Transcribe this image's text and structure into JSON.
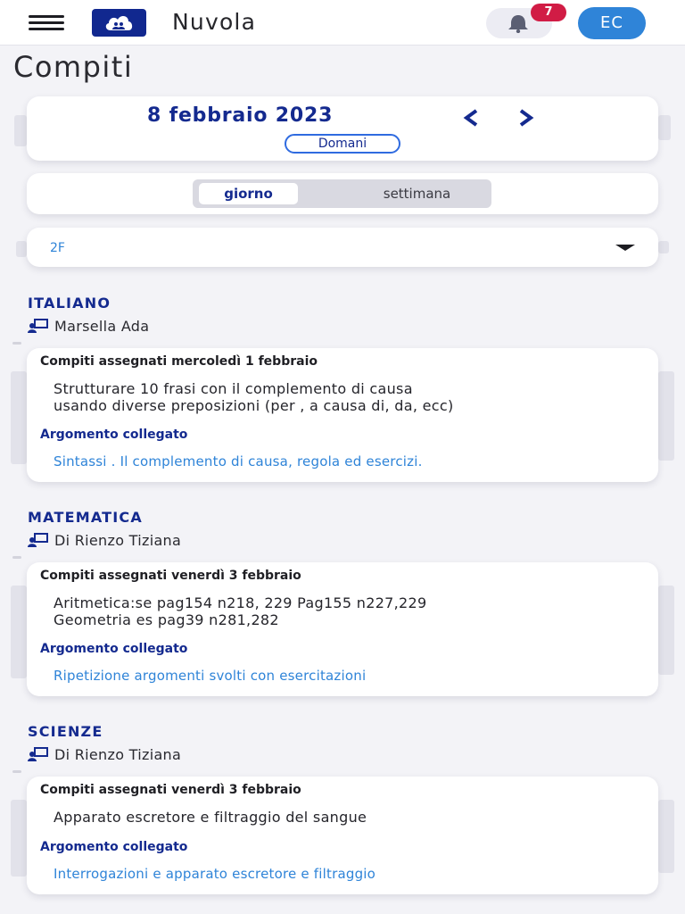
{
  "header": {
    "app_title": "Nuvola",
    "notifications_count": "7",
    "user_initials": "EC",
    "colors": {
      "brand": "#11288f",
      "badge": "#d11c45",
      "avatar": "#2f84d8"
    }
  },
  "page_title": "Compiti",
  "date_nav": {
    "date": "8 febbraio 2023",
    "tomorrow_label": "Domani",
    "prev_icon": "chevron-left-icon",
    "next_icon": "chevron-right-icon"
  },
  "view_toggle": {
    "day_label": "giorno",
    "week_label": "settimana",
    "selected": "giorno"
  },
  "class_select": {
    "value": "2F"
  },
  "subjects": [
    {
      "name": "ITALIANO",
      "teacher": "Marsella Ada",
      "assigned": "Compiti assegnati mercoledì 1 febbraio",
      "lines": [
        "Strutturare 10 frasi con il complemento di causa",
        "usando diverse preposizioni (per , a causa di, da, ecc)"
      ],
      "topic_label": "Argomento collegato",
      "topic": "Sintassi . Il complemento di causa, regola ed esercizi."
    },
    {
      "name": "MATEMATICA",
      "teacher": "Di Rienzo Tiziana",
      "assigned": "Compiti assegnati venerdì 3 febbraio",
      "lines": [
        "Aritmetica:se pag154 n218, 229 Pag155 n227,229",
        "Geometria es pag39 n281,282"
      ],
      "topic_label": "Argomento collegato",
      "topic": "Ripetizione argomenti svolti con esercitazioni"
    },
    {
      "name": "SCIENZE",
      "teacher": "Di Rienzo Tiziana",
      "assigned": "Compiti assegnati venerdì 3 febbraio",
      "lines": [
        "Apparato escretore e filtraggio del sangue"
      ],
      "topic_label": "Argomento collegato",
      "topic": "Interrogazioni e apparato escretore e filtraggio"
    }
  ]
}
